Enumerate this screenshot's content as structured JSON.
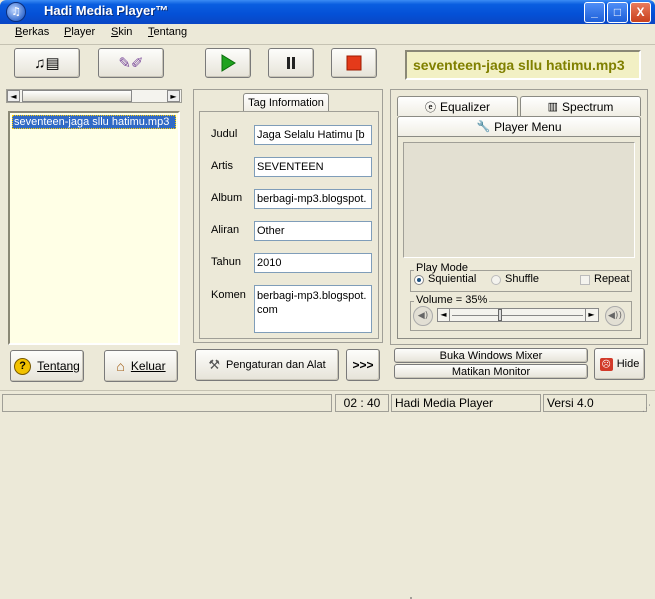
{
  "window": {
    "title": "Hadi Media Player™",
    "minimize": "_",
    "maximize": "□",
    "close": "X"
  },
  "menu": [
    "Berkas",
    "Player",
    "Skin",
    "Tentang"
  ],
  "now_playing": "seventeen-jaga sllu hatimu.mp3",
  "playlist": {
    "items": [
      "seventeen-jaga sllu hatimu.mp3"
    ]
  },
  "buttons": {
    "tentang": "Tentang",
    "keluar": "Keluar",
    "pengaturan": "Pengaturan dan Alat",
    "more": ">>>",
    "buka_mixer": "Buka Windows Mixer",
    "matikan_monitor": "Matikan Monitor",
    "hide": "Hide"
  },
  "tag": {
    "tab": "Tag Information",
    "fields": [
      {
        "label": "Judul",
        "value": "Jaga Selalu Hatimu [b"
      },
      {
        "label": "Artis",
        "value": "SEVENTEEN"
      },
      {
        "label": "Album",
        "value": "berbagi-mp3.blogspot."
      },
      {
        "label": "Aliran",
        "value": "Other"
      },
      {
        "label": "Tahun",
        "value": "2010"
      },
      {
        "label": "Komen",
        "value": "berbagi-mp3.blogspot.com"
      }
    ]
  },
  "player_tabs": {
    "equalizer": "Equalizer",
    "spectrum": "Spectrum",
    "player_menu": "Player Menu"
  },
  "play_mode": {
    "title": "Play Mode",
    "sequential": "Squiential",
    "shuffle": "Shuffle",
    "repeat": "Repeat",
    "selected": "Squiential"
  },
  "volume": {
    "label": "Volume = 35%",
    "value": 35
  },
  "status": {
    "time": "02 : 40",
    "app": "Hadi Media Player",
    "version": "Versi 4.0"
  },
  "colors": {
    "title_bar": "#0450d6",
    "now_playing_text": "#808000",
    "playlist_bg": "#ffffe6",
    "selected_item": "#316ac5",
    "play_green": "#1fa21f",
    "stop_red": "#e43a1a"
  }
}
